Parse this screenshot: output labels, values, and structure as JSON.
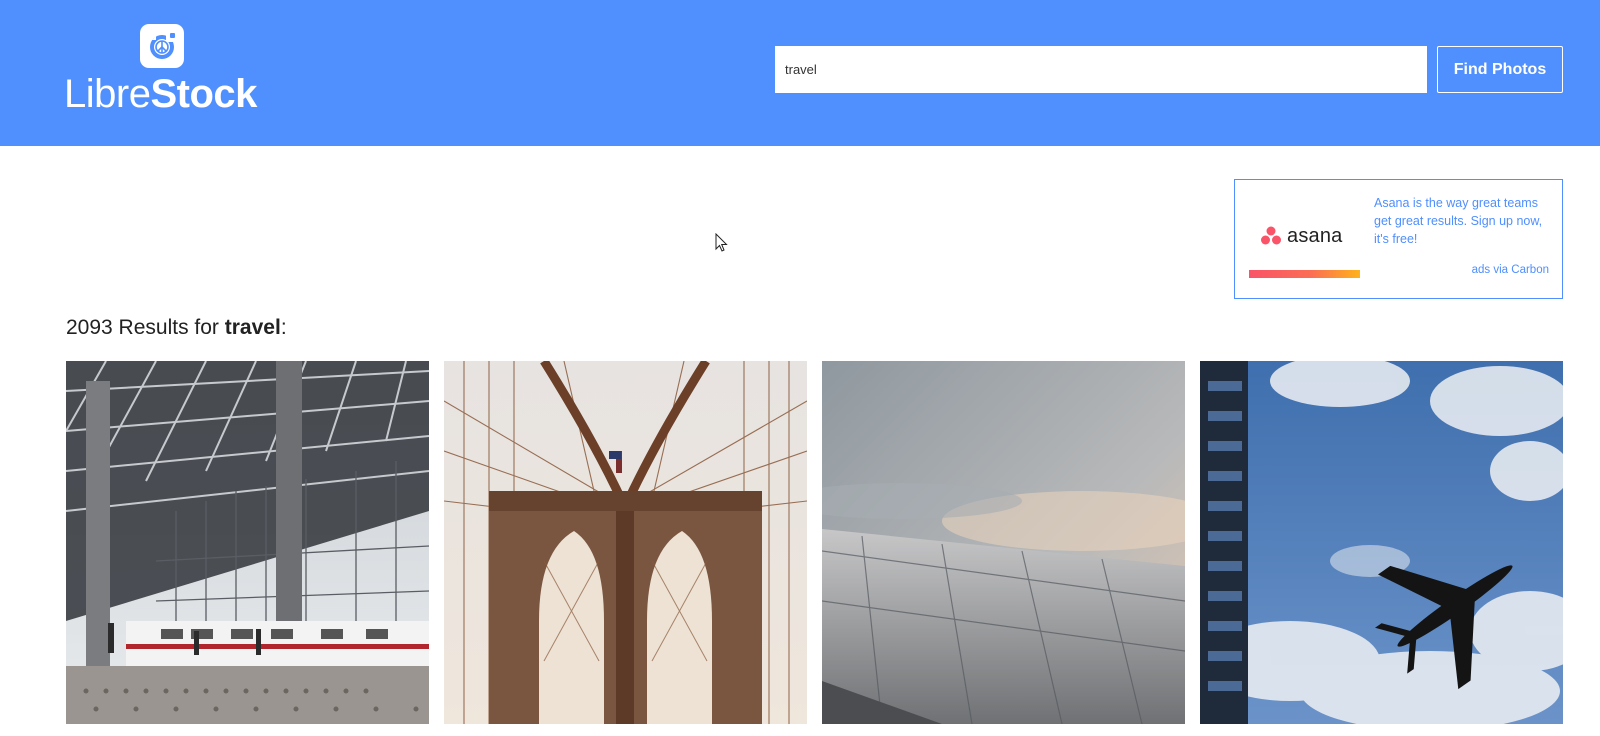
{
  "header": {
    "logo": {
      "part_light": "Libre",
      "part_bold": "Stock",
      "icon": "camera-peace-icon"
    },
    "search": {
      "value": "travel",
      "placeholder": ""
    },
    "find_button_label": "Find Photos"
  },
  "ad": {
    "brand": "asana",
    "text": "Asana is the way great teams get great results. Sign up now, it's free!",
    "via": "ads via Carbon",
    "colors": {
      "brand_dots": "#f95468",
      "bar_start": "#f95468",
      "bar_end": "#ffb21a"
    }
  },
  "results": {
    "count": "2093",
    "prefix": " Results for ",
    "query": "travel",
    "suffix": ":",
    "photos": [
      {
        "subject": "train station with glass roof"
      },
      {
        "subject": "suspension bridge tower and cables"
      },
      {
        "subject": "airplane wing above clouds"
      },
      {
        "subject": "airplane silhouette in blue sky"
      }
    ]
  },
  "colors": {
    "accent": "#4f8ffe"
  }
}
